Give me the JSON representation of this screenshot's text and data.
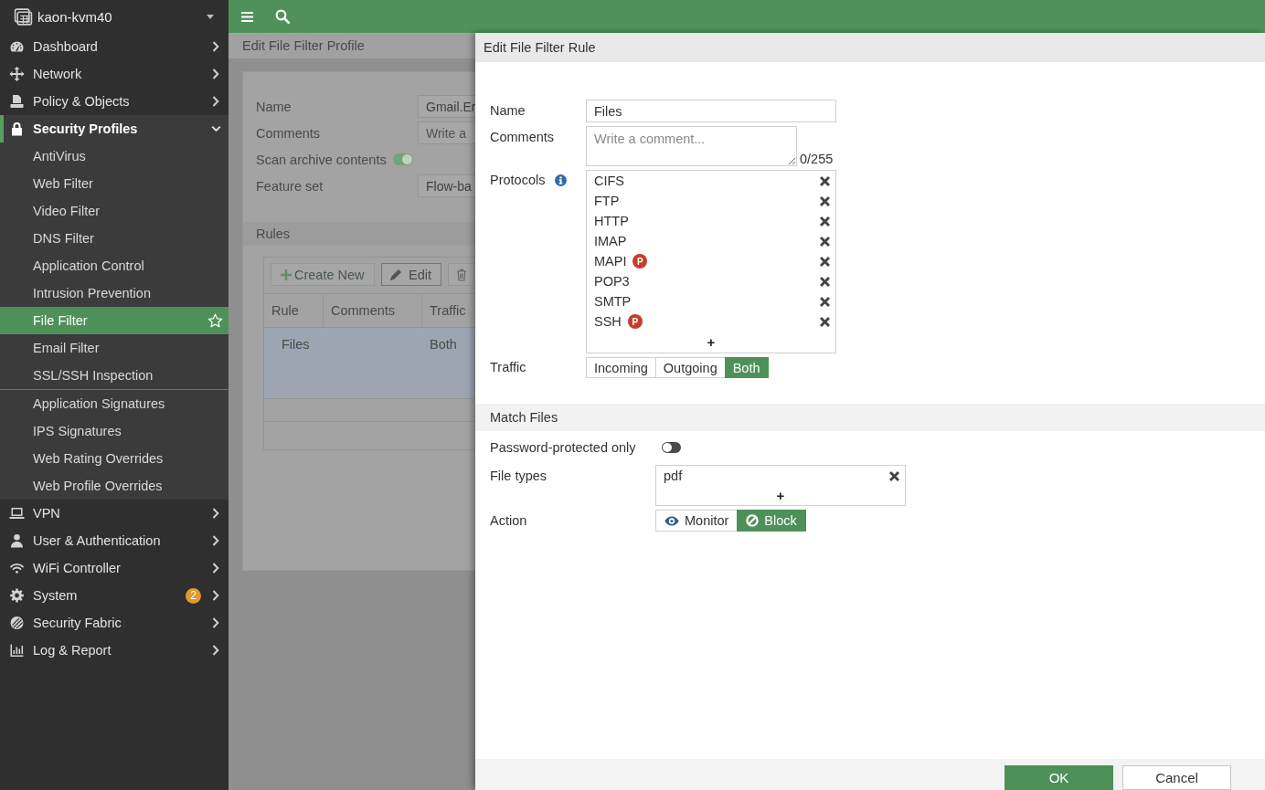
{
  "sidebar": {
    "device": "kaon-kvm40",
    "items": [
      {
        "label": "Dashboard",
        "selected": false,
        "expanded": false
      },
      {
        "label": "Network",
        "selected": false,
        "expanded": false
      },
      {
        "label": "Policy & Objects",
        "selected": false,
        "expanded": false
      },
      {
        "label": "Security Profiles",
        "selected": true,
        "expanded": true,
        "child_groups": [
          {
            "children": [
              {
                "label": "AntiVirus",
                "selected": false
              },
              {
                "label": "Web Filter",
                "selected": false
              },
              {
                "label": "Video Filter",
                "selected": false
              },
              {
                "label": "DNS Filter",
                "selected": false
              },
              {
                "label": "Application Control",
                "selected": false
              },
              {
                "label": "Intrusion Prevention",
                "selected": false
              },
              {
                "label": "File Filter",
                "selected": true
              },
              {
                "label": "Email Filter",
                "selected": false
              },
              {
                "label": "SSL/SSH Inspection",
                "selected": false
              }
            ]
          },
          {
            "children": [
              {
                "label": "Application Signatures",
                "selected": false
              },
              {
                "label": "IPS Signatures",
                "selected": false
              },
              {
                "label": "Web Rating Overrides",
                "selected": false
              },
              {
                "label": "Web Profile Overrides",
                "selected": false
              }
            ]
          }
        ]
      },
      {
        "label": "VPN",
        "selected": false,
        "expanded": false
      },
      {
        "label": "User & Authentication",
        "selected": false,
        "expanded": false
      },
      {
        "label": "WiFi Controller",
        "selected": false,
        "expanded": false
      },
      {
        "label": "System",
        "selected": false,
        "expanded": false,
        "badge": "2"
      },
      {
        "label": "Security Fabric",
        "selected": false,
        "expanded": false
      },
      {
        "label": "Log & Report",
        "selected": false,
        "expanded": false
      }
    ]
  },
  "profile_page": {
    "title": "Edit File Filter Profile",
    "fields": [
      {
        "kind": "text",
        "label": "Name",
        "value": "Gmail.Er"
      },
      {
        "kind": "text",
        "label": "Comments",
        "placeholder": "Write a"
      },
      {
        "kind": "toggle",
        "label": "Scan archive contents",
        "on": true
      },
      {
        "kind": "text",
        "label": "Feature set",
        "value": "Flow-ba"
      }
    ],
    "rules": {
      "title": "Rules",
      "toolbar": [
        {
          "kind": "create",
          "label": "Create New"
        },
        {
          "kind": "edit",
          "label": "Edit"
        },
        {
          "kind": "delete"
        }
      ],
      "columns": [
        "Rule",
        "Comments",
        "Traffic"
      ],
      "rows": [
        {
          "selected": true,
          "cells": [
            "Files",
            null,
            "Both"
          ]
        }
      ]
    }
  },
  "rule_panel": {
    "title": "Edit File Filter Rule",
    "name": {
      "label": "Name",
      "value": "Files"
    },
    "comments": {
      "label": "Comments",
      "placeholder": "Write a comment...",
      "counter": "0/255"
    },
    "protocols": {
      "label": "Protocols",
      "items": [
        {
          "label": "CIFS"
        },
        {
          "label": "FTP"
        },
        {
          "label": "HTTP"
        },
        {
          "label": "IMAP"
        },
        {
          "label": "MAPI",
          "badge": "P"
        },
        {
          "label": "POP3"
        },
        {
          "label": "SMTP"
        },
        {
          "label": "SSH",
          "badge": "P"
        }
      ],
      "add": "+"
    },
    "traffic": {
      "label": "Traffic",
      "options": [
        {
          "label": "Incoming",
          "selected": false
        },
        {
          "label": "Outgoing",
          "selected": false
        },
        {
          "label": "Both",
          "selected": true
        }
      ]
    },
    "match_files": {
      "title": "Match Files",
      "password_protected": {
        "label": "Password-protected only",
        "on": false
      },
      "file_types": {
        "label": "File types",
        "items": [
          {
            "label": "pdf"
          }
        ],
        "add": "+"
      },
      "action": {
        "label": "Action",
        "options": [
          {
            "kind": "monitor",
            "label": "Monitor",
            "selected": false
          },
          {
            "kind": "block",
            "label": "Block",
            "selected": true
          }
        ]
      }
    },
    "buttons": [
      {
        "kind": "primary",
        "label": "OK"
      },
      {
        "kind": "secondary",
        "label": "Cancel"
      }
    ]
  }
}
